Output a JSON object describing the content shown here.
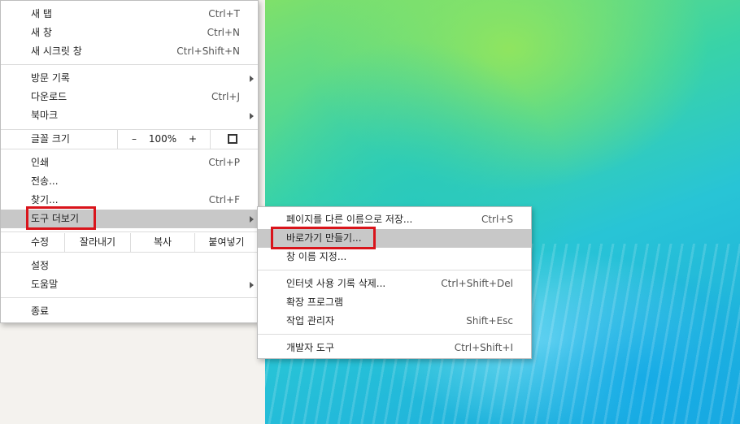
{
  "menu": {
    "new_tab": {
      "label": "새 탭",
      "shortcut": "Ctrl+T"
    },
    "new_window": {
      "label": "새 창",
      "shortcut": "Ctrl+N"
    },
    "incognito": {
      "label": "새 시크릿 창",
      "shortcut": "Ctrl+Shift+N"
    },
    "history": {
      "label": "방문 기록"
    },
    "downloads": {
      "label": "다운로드",
      "shortcut": "Ctrl+J"
    },
    "bookmarks": {
      "label": "북마크"
    },
    "zoom": {
      "label": "글꼴 크기",
      "minus": "–",
      "value": "100%",
      "plus": "+"
    },
    "print": {
      "label": "인쇄",
      "shortcut": "Ctrl+P"
    },
    "cast": {
      "label": "전송..."
    },
    "find": {
      "label": "찾기...",
      "shortcut": "Ctrl+F"
    },
    "more_tools": {
      "label": "도구 더보기"
    },
    "edit": {
      "label": "수정",
      "cut": "잘라내기",
      "copy": "복사",
      "paste": "붙여넣기"
    },
    "settings": {
      "label": "설정"
    },
    "help": {
      "label": "도움말"
    },
    "exit": {
      "label": "종료"
    }
  },
  "submenu": {
    "save_page": {
      "label": "페이지를 다른 이름으로 저장...",
      "shortcut": "Ctrl+S"
    },
    "create_shortcut": {
      "label": "바로가기 만들기..."
    },
    "name_window": {
      "label": "창 이름 지정..."
    },
    "clear_data": {
      "label": "인터넷 사용 기록 삭제...",
      "shortcut": "Ctrl+Shift+Del"
    },
    "extensions": {
      "label": "확장 프로그램"
    },
    "task_manager": {
      "label": "작업 관리자",
      "shortcut": "Shift+Esc"
    },
    "dev_tools": {
      "label": "개발자 도구",
      "shortcut": "Ctrl+Shift+I"
    }
  },
  "colors": {
    "highlight": "#c8c8c8",
    "annotation": "#d9141b"
  }
}
